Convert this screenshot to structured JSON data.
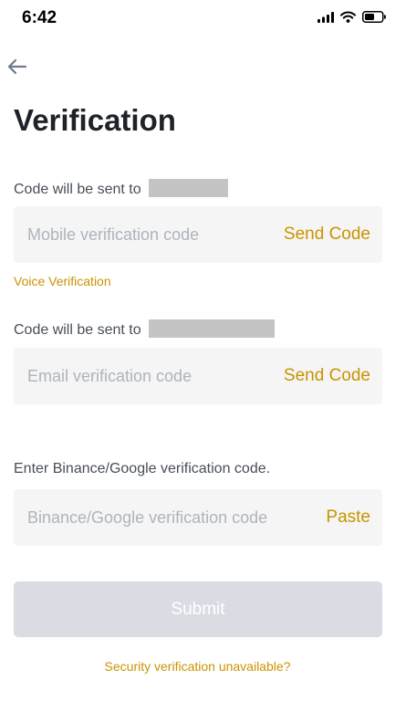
{
  "status_bar": {
    "time": "6:42"
  },
  "page": {
    "title": "Verification"
  },
  "mobile": {
    "label": "Code will be sent to",
    "placeholder": "Mobile verification code",
    "action": "Send Code",
    "voice_link": "Voice Verification"
  },
  "email": {
    "label": "Code will be sent to",
    "placeholder": "Email verification code",
    "action": "Send Code"
  },
  "authenticator": {
    "label": "Enter Binance/Google verification code.",
    "placeholder": "Binance/Google verification code",
    "action": "Paste"
  },
  "submit": {
    "label": "Submit"
  },
  "footer": {
    "security_link": "Security verification unavailable?"
  },
  "colors": {
    "accent": "#c99400",
    "field_bg": "#f5f5f5",
    "button_disabled": "#d9dde3",
    "mask": "#c4c4c4"
  },
  "icons": [
    "signal-icon",
    "wifi-icon",
    "battery-icon",
    "back-arrow-icon"
  ]
}
